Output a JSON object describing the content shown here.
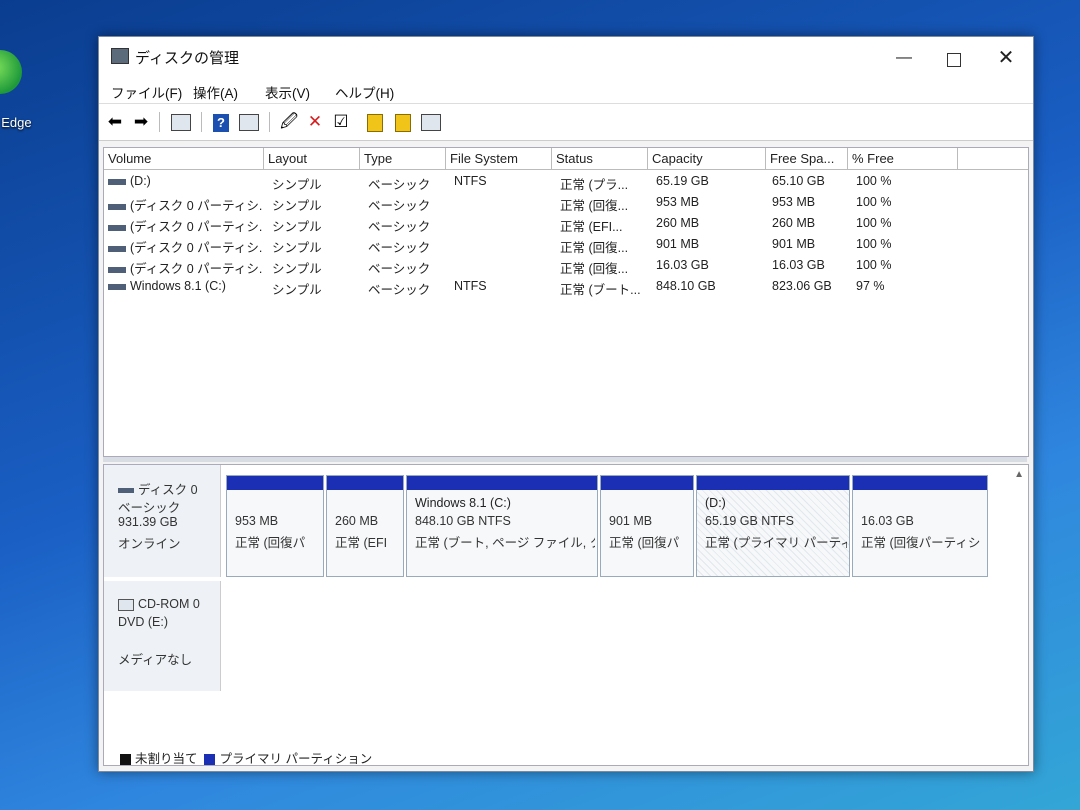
{
  "desktop": {
    "icon_label": "t Edge"
  },
  "window": {
    "title": "ディスクの管理",
    "controls": {
      "minimize": "—",
      "maximize": "",
      "close": "✕"
    }
  },
  "menu": [
    "ファイル(F)",
    "操作(A)",
    "表示(V)",
    "ヘルプ(H)"
  ],
  "toolbar": {
    "icons": [
      "back-arrow-icon",
      "forward-arrow-icon",
      "console-tree-icon",
      "help-icon",
      "properties-icon",
      "connect-icon",
      "delete-icon",
      "check-icon",
      "yellow-volume-icon",
      "yellow-volume-2-icon",
      "list-view-icon"
    ]
  },
  "volume_table": {
    "columns": [
      "Volume",
      "Layout",
      "Type",
      "File System",
      "Status",
      "Capacity",
      "Free Spa...",
      "% Free"
    ],
    "rows": [
      [
        "(D:)",
        "シンプル",
        "ベーシック",
        "NTFS",
        "正常 (プラ...",
        "65.19 GB",
        "65.10 GB",
        "100 %"
      ],
      [
        "(ディスク 0 パーティシ...",
        "シンプル",
        "ベーシック",
        "",
        "正常 (回復...",
        "953 MB",
        "953 MB",
        "100 %"
      ],
      [
        "(ディスク 0 パーティシ...",
        "シンプル",
        "ベーシック",
        "",
        "正常 (EFI...",
        "260 MB",
        "260 MB",
        "100 %"
      ],
      [
        "(ディスク 0 パーティシ...",
        "シンプル",
        "ベーシック",
        "",
        "正常 (回復...",
        "901 MB",
        "901 MB",
        "100 %"
      ],
      [
        "(ディスク 0 パーティシ...",
        "シンプル",
        "ベーシック",
        "",
        "正常 (回復...",
        "16.03 GB",
        "16.03 GB",
        "100 %"
      ],
      [
        "Windows 8.1 (C:)",
        "シンプル",
        "ベーシック",
        "NTFS",
        "正常 (ブート...",
        "848.10 GB",
        "823.06 GB",
        "97 %"
      ]
    ]
  },
  "disk0": {
    "name": "ディスク 0",
    "type": "ベーシック",
    "size": "931.39 GB",
    "state": "オンライン",
    "partitions": [
      {
        "name": "",
        "size": "953 MB",
        "status": "正常 (回復パ"
      },
      {
        "name": "",
        "size": "260 MB",
        "status": "正常 (EFI"
      },
      {
        "name": "Windows 8.1 (C:)",
        "size": "848.10 GB NTFS",
        "status": "正常 (ブート, ページ ファイル, ク"
      },
      {
        "name": "",
        "size": "901 MB",
        "status": "正常 (回復パ"
      },
      {
        "name": "(D:)",
        "size": "65.19 GB NTFS",
        "status": "正常 (プライマリ パーティ"
      },
      {
        "name": "",
        "size": "16.03 GB",
        "status": "正常 (回復パーティシ"
      }
    ]
  },
  "cdrom0": {
    "name": "CD-ROM 0",
    "drive": "DVD (E:)",
    "state": "メディアなし"
  },
  "legend": {
    "unallocated": "未割り当て",
    "primary": "プライマリ パーティション"
  },
  "colors": {
    "partition_bar": "#1a2fb3",
    "unallocated": "#111111",
    "primary": "#1a2fb3"
  }
}
